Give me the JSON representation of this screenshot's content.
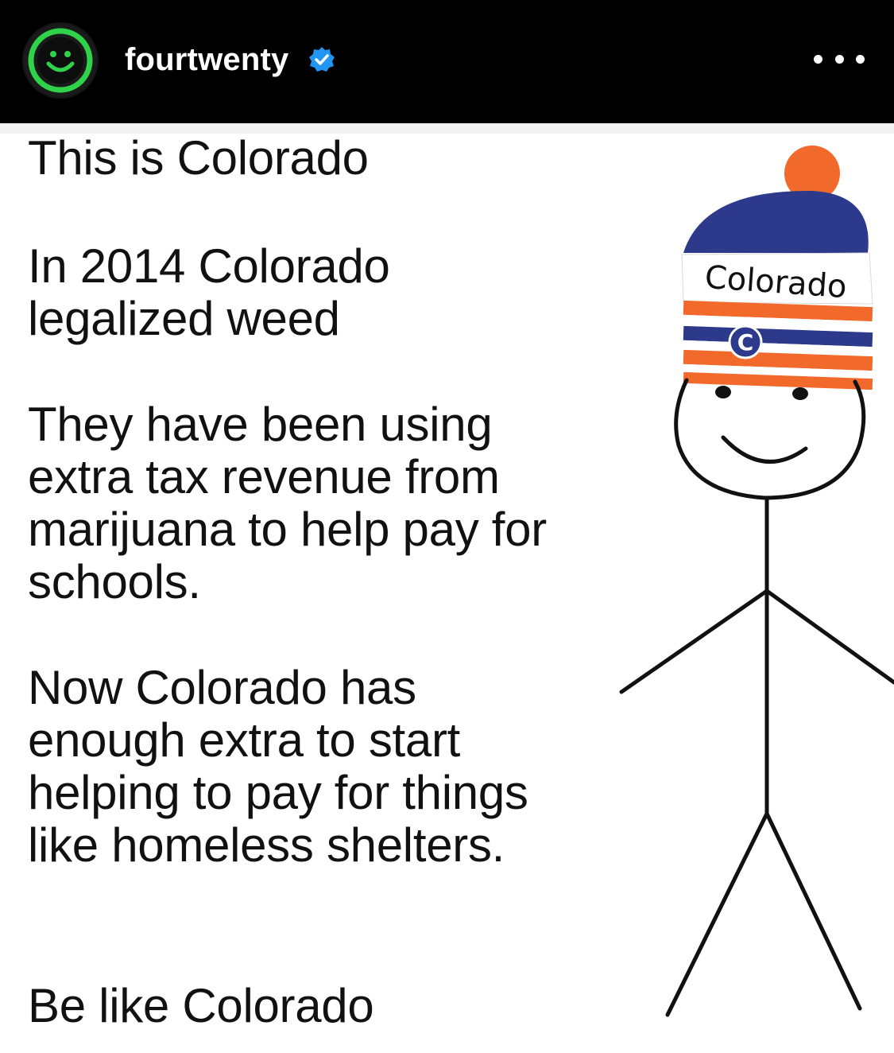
{
  "post": {
    "username": "fourtwenty",
    "verified": true,
    "more_label": "More options"
  },
  "meme": {
    "paragraphs": [
      "This is Colorado",
      "In 2014 Colorado\nlegalized weed",
      "They have been using\nextra tax revenue from\nmarijuana to help pay for\nschools.",
      "Now Colorado has\nenough extra to start\nhelping to pay for things\nlike homeless shelters.",
      "Be like Colorado"
    ],
    "hat_text": "Colorado",
    "hat_letter": "C"
  },
  "icons": {
    "avatar": "smiley-face-icon",
    "verified": "verified-badge-icon",
    "more": "more-horizontal-icon"
  },
  "colors": {
    "header_bg": "#000000",
    "avatar_ring": "#2fd34a",
    "verified_blue": "#2196f3",
    "hat_orange": "#f26a2b",
    "hat_navy": "#2d3a8c",
    "text": "#111111"
  }
}
